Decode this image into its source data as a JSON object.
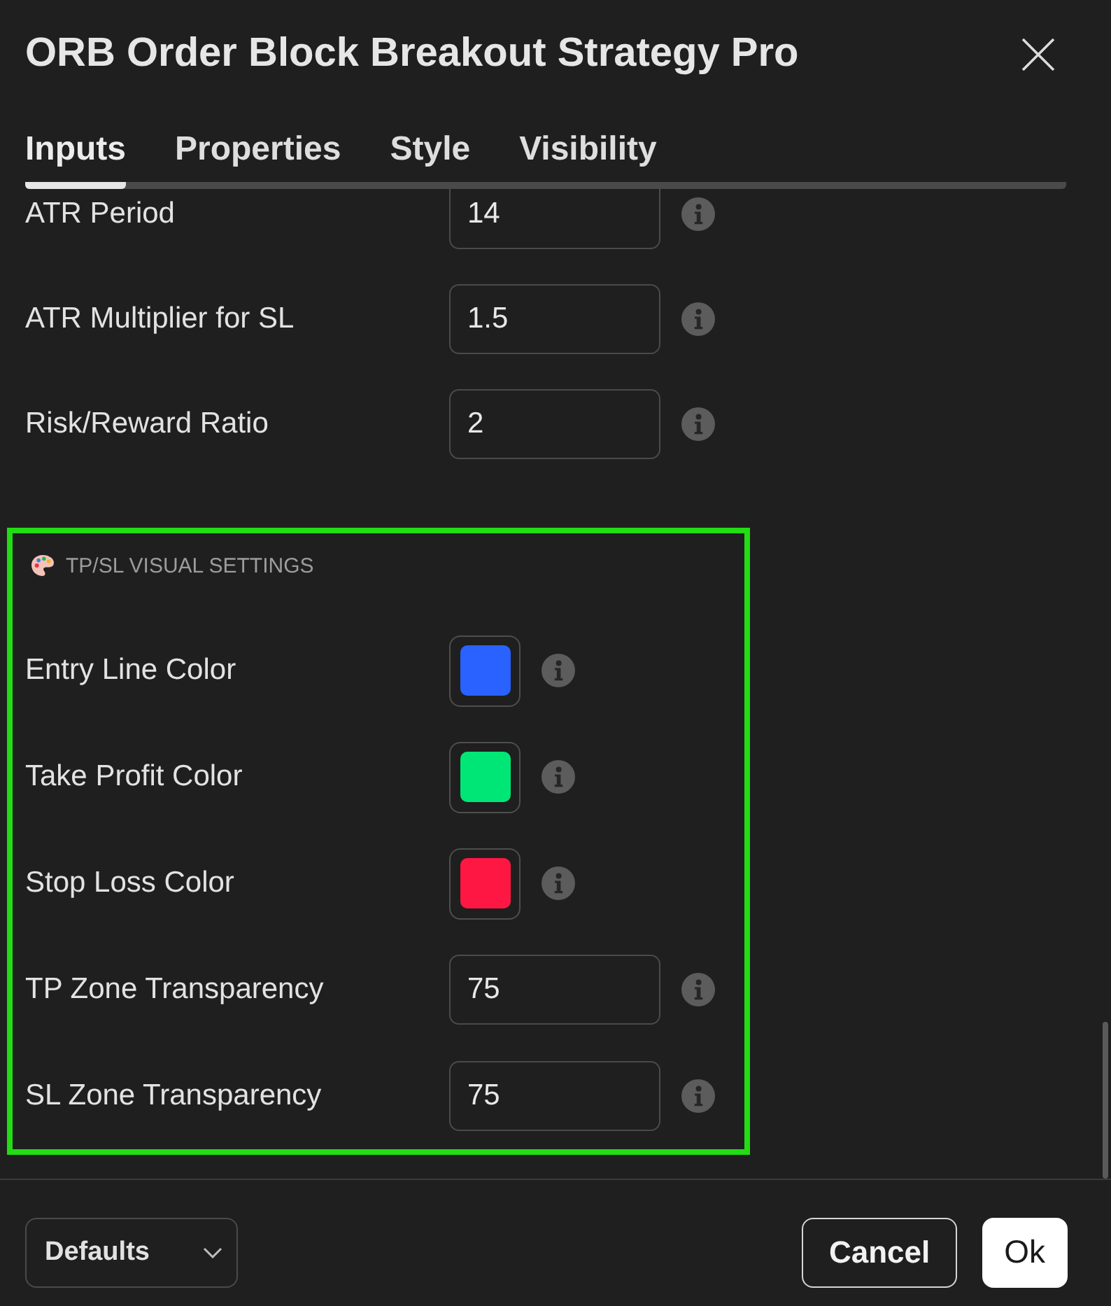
{
  "window": {
    "title": "ORB Order Block Breakout Strategy Pro"
  },
  "tabs": [
    {
      "label": "Inputs",
      "selected": true
    },
    {
      "label": "Properties",
      "selected": false
    },
    {
      "label": "Style",
      "selected": false
    },
    {
      "label": "Visibility",
      "selected": false
    }
  ],
  "inputs": [
    {
      "kind": "number",
      "label": "ATR Period",
      "value": "14"
    },
    {
      "kind": "number",
      "label": "ATR Multiplier for SL",
      "value": "1.5"
    },
    {
      "kind": "number",
      "label": "Risk/Reward Ratio",
      "value": "2"
    }
  ],
  "section": {
    "title": "TP/SL VISUAL SETTINGS",
    "highlighted": true,
    "rows": [
      {
        "kind": "color",
        "label": "Entry Line Color",
        "color": "#2962ff"
      },
      {
        "kind": "color",
        "label": "Take Profit Color",
        "color": "#00e676"
      },
      {
        "kind": "color",
        "label": "Stop Loss Color",
        "color": "#ff1744"
      },
      {
        "kind": "number",
        "label": "TP Zone Transparency",
        "value": "75"
      },
      {
        "kind": "number",
        "label": "SL Zone Transparency",
        "value": "75"
      }
    ]
  },
  "footer": {
    "defaults_menu": {
      "label": "Defaults"
    },
    "buttons": [
      {
        "label": "Cancel",
        "kind": "secondary"
      },
      {
        "label": "Ok",
        "kind": "primary"
      }
    ]
  }
}
